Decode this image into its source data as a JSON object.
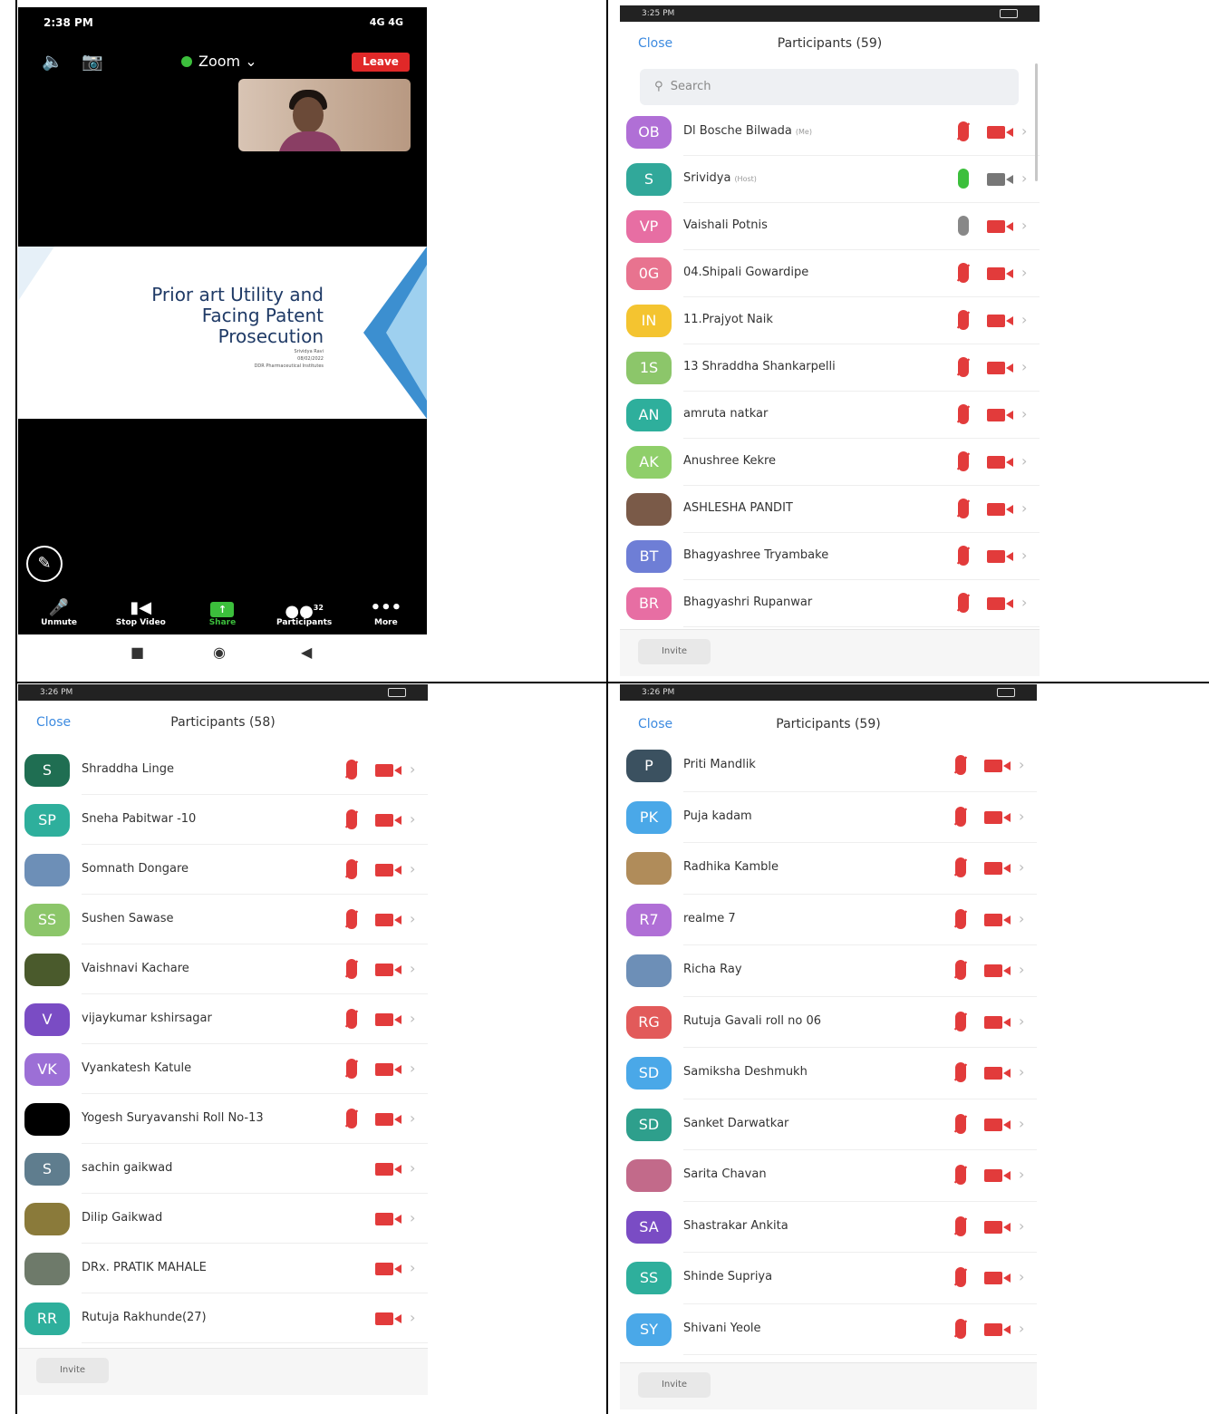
{
  "zoom_screen": {
    "status_time": "2:38 PM",
    "status_icons": "4G 4G",
    "meeting_title": "Zoom",
    "leave_label": "Leave",
    "slide_title": "Prior art Utility and\nFacing Patent\nProsecution",
    "slide_subtitle": "Srividya Ravi\n08/02/2022\nDDR Pharmaceutical Institutes",
    "toolbar": [
      {
        "label": "Unmute",
        "icon": "mic-off-icon"
      },
      {
        "label": "Stop Video",
        "icon": "video-camera-icon"
      },
      {
        "label": "Share",
        "icon": "share-arrow-icon"
      },
      {
        "label": "Participants",
        "icon": "participants-icon",
        "count": "32"
      },
      {
        "label": "More",
        "icon": "more-dots-icon"
      }
    ]
  },
  "panel_top_right": {
    "status_time": "3:25 PM",
    "close_label": "Close",
    "title": "Participants (59)",
    "search_placeholder": "Search",
    "invite_label": "Invite",
    "participants": [
      {
        "initials": "OB",
        "name": "Dl Bosche Bilwada",
        "tag": "(Me)",
        "color": "#b06fd6",
        "mic": "off",
        "cam": "off"
      },
      {
        "initials": "S",
        "name": "Srividya",
        "tag": "(Host)",
        "color": "#31a89a",
        "mic": "on",
        "cam": "on"
      },
      {
        "initials": "VP",
        "name": "Vaishali Potnis",
        "tag": "",
        "color": "#e76ea3",
        "mic": "idle",
        "cam": "off"
      },
      {
        "initials": "0G",
        "name": "04.Shipali Gowardipe",
        "tag": "",
        "color": "#e8738f",
        "mic": "off",
        "cam": "off"
      },
      {
        "initials": "IN",
        "name": "11.Prajyot Naik",
        "tag": "",
        "color": "#f4c430",
        "mic": "off",
        "cam": "off"
      },
      {
        "initials": "1S",
        "name": "13 Shraddha Shankarpelli",
        "tag": "",
        "color": "#8cc66a",
        "mic": "off",
        "cam": "off"
      },
      {
        "initials": "AN",
        "name": "amruta natkar",
        "tag": "",
        "color": "#2eaf9c",
        "mic": "off",
        "cam": "off"
      },
      {
        "initials": "AK",
        "name": "Anushree Kekre",
        "tag": "",
        "color": "#8fcf6a",
        "mic": "off",
        "cam": "off"
      },
      {
        "initials": "",
        "name": "ASHLESHA PANDIT",
        "tag": "",
        "color": "#7a5a48",
        "mic": "off",
        "cam": "off",
        "photo": true
      },
      {
        "initials": "BT",
        "name": "Bhagyashree Tryambake",
        "tag": "",
        "color": "#6e7ed6",
        "mic": "off",
        "cam": "off"
      },
      {
        "initials": "BR",
        "name": "Bhagyashri Rupanwar",
        "tag": "",
        "color": "#e76ea3",
        "mic": "off",
        "cam": "off"
      }
    ]
  },
  "panel_bottom_left": {
    "status_time": "3:26 PM",
    "close_label": "Close",
    "title": "Participants (58)",
    "invite_label": "Invite",
    "participants": [
      {
        "initials": "S",
        "name": "Shraddha Linge",
        "color": "#1f6e52",
        "mic": "off",
        "cam": "off"
      },
      {
        "initials": "SP",
        "name": "Sneha Pabitwar -10",
        "color": "#2eaf9c",
        "mic": "off",
        "cam": "off"
      },
      {
        "initials": "",
        "name": "Somnath Dongare",
        "color": "#6d8fb7",
        "mic": "off",
        "cam": "off",
        "photo": true
      },
      {
        "initials": "SS",
        "name": "Sushen Sawase",
        "color": "#8cc66a",
        "mic": "off",
        "cam": "off"
      },
      {
        "initials": "",
        "name": "Vaishnavi Kachare",
        "color": "#4a5a2c",
        "mic": "off",
        "cam": "off",
        "photo": true
      },
      {
        "initials": "V",
        "name": "vijaykumar kshirsagar",
        "color": "#7a4cc4",
        "mic": "off",
        "cam": "off"
      },
      {
        "initials": "VK",
        "name": "Vyankatesh Katule",
        "color": "#9c6fd6",
        "mic": "off",
        "cam": "off"
      },
      {
        "initials": "",
        "name": "Yogesh Suryavanshi Roll No-13",
        "color": "#000000",
        "mic": "off",
        "cam": "off",
        "photo": true
      },
      {
        "initials": "S",
        "name": "sachin gaikwad",
        "color": "#5f7d8e",
        "mic": "none",
        "cam": "off"
      },
      {
        "initials": "",
        "name": "Dilip Gaikwad",
        "color": "#8a7a3a",
        "mic": "none",
        "cam": "off",
        "photo": true
      },
      {
        "initials": "",
        "name": "DRx. PRATIK MAHALE",
        "color": "#6e7a6a",
        "mic": "none",
        "cam": "off",
        "photo": true
      },
      {
        "initials": "RR",
        "name": "Rutuja Rakhunde(27)",
        "color": "#2eaf9c",
        "mic": "none",
        "cam": "off"
      }
    ]
  },
  "panel_bottom_right": {
    "status_time": "3:26 PM",
    "close_label": "Close",
    "title": "Participants (59)",
    "invite_label": "Invite",
    "participants": [
      {
        "initials": "P",
        "name": "Priti Mandlik",
        "color": "#3b5160",
        "mic": "off",
        "cam": "off"
      },
      {
        "initials": "PK",
        "name": "Puja kadam",
        "color": "#4aa8e8",
        "mic": "off",
        "cam": "off"
      },
      {
        "initials": "",
        "name": "Radhika Kamble",
        "color": "#b08c5a",
        "mic": "off",
        "cam": "off",
        "photo": true
      },
      {
        "initials": "R7",
        "name": "realme 7",
        "color": "#b06fd6",
        "mic": "off",
        "cam": "off"
      },
      {
        "initials": "",
        "name": "Richa Ray",
        "color": "#6d8fb7",
        "mic": "off",
        "cam": "off",
        "photo": true
      },
      {
        "initials": "RG",
        "name": "Rutuja Gavali roll no 06",
        "color": "#e25a5a",
        "mic": "off",
        "cam": "off"
      },
      {
        "initials": "SD",
        "name": "Samiksha Deshmukh",
        "color": "#4aa8e8",
        "mic": "off",
        "cam": "off"
      },
      {
        "initials": "SD",
        "name": "Sanket Darwatkar",
        "color": "#2e9f8c",
        "mic": "off",
        "cam": "off"
      },
      {
        "initials": "",
        "name": "Sarita Chavan",
        "color": "#c26a8a",
        "mic": "off",
        "cam": "off",
        "photo": true
      },
      {
        "initials": "SA",
        "name": "Shastrakar Ankita",
        "color": "#7a4cc4",
        "mic": "off",
        "cam": "off"
      },
      {
        "initials": "SS",
        "name": "Shinde Supriya",
        "color": "#2eaf9c",
        "mic": "off",
        "cam": "off"
      },
      {
        "initials": "SY",
        "name": "Shivani Yeole",
        "color": "#4aa8e8",
        "mic": "off",
        "cam": "off"
      }
    ]
  }
}
